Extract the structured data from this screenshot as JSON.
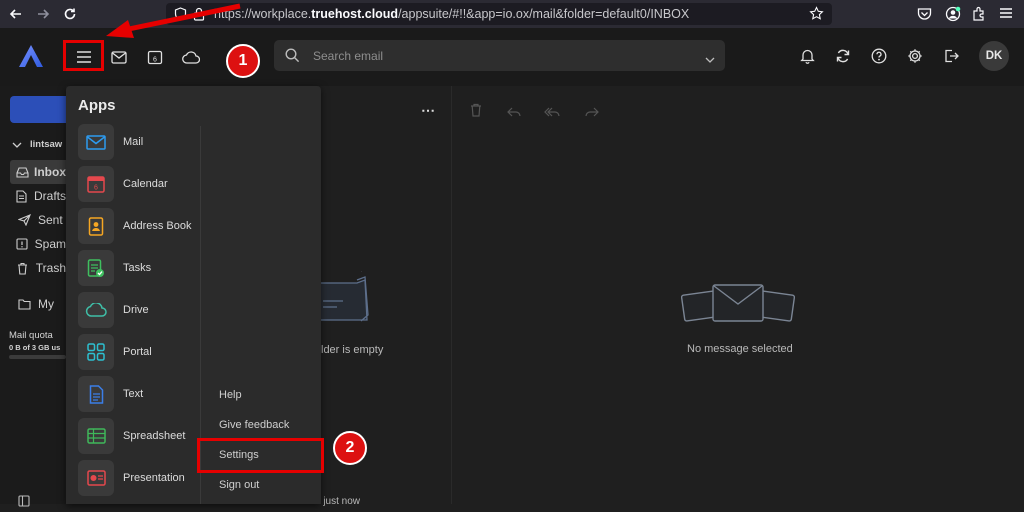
{
  "browser": {
    "url_prefix": "https://workplace.",
    "url_domain": "truehost.cloud",
    "url_suffix": "/appsuite/#!!&app=io.ox/mail&folder=default0/INBOX"
  },
  "header": {
    "search_placeholder": "Search email",
    "calendar_day": "6",
    "avatar_initials": "DK"
  },
  "sidebar": {
    "account": "lintsaw",
    "folders": [
      {
        "label": "Inbox",
        "icon": "inbox-icon"
      },
      {
        "label": "Drafts",
        "icon": "drafts-icon"
      },
      {
        "label": "Sent",
        "icon": "sent-icon"
      },
      {
        "label": "Spam",
        "icon": "spam-icon"
      },
      {
        "label": "Trash",
        "icon": "trash-icon"
      }
    ],
    "my_folders": "My",
    "quota_label": "Mail quota",
    "quota_value": "0 B of 3 GB us",
    "quota_fraction": 0
  },
  "list_pane": {
    "empty_text": "lder is empty",
    "bottom_text": "d just now"
  },
  "detail_pane": {
    "empty_text": "No message selected"
  },
  "apps_menu": {
    "title": "Apps",
    "apps": [
      {
        "label": "Mail",
        "icon": "mail-app-icon"
      },
      {
        "label": "Calendar",
        "icon": "calendar-app-icon"
      },
      {
        "label": "Address Book",
        "icon": "address-book-icon"
      },
      {
        "label": "Tasks",
        "icon": "tasks-icon"
      },
      {
        "label": "Drive",
        "icon": "drive-icon"
      },
      {
        "label": "Portal",
        "icon": "portal-icon"
      },
      {
        "label": "Text",
        "icon": "text-doc-icon"
      },
      {
        "label": "Spreadsheet",
        "icon": "spreadsheet-icon"
      },
      {
        "label": "Presentation",
        "icon": "presentation-icon"
      }
    ],
    "links": {
      "help": "Help",
      "feedback": "Give feedback",
      "settings": "Settings",
      "signout": "Sign out"
    },
    "calendar_tile_day": "6"
  },
  "annotations": {
    "step1": "1",
    "step2": "2",
    "color": "#e60000"
  }
}
